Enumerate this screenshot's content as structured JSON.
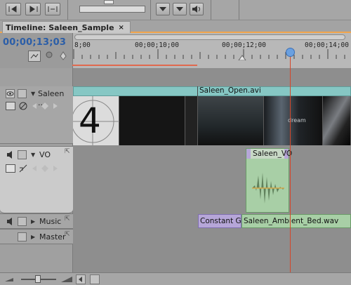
{
  "panel": {
    "tab_title": "Timeline: Saleen_Sample",
    "tab_close": "×",
    "timecode": "00;00;13;03"
  },
  "ruler": {
    "labels": [
      "8;00",
      "00;00;10;00",
      "00;00;12;00",
      "00;00;14;00"
    ]
  },
  "tracks": {
    "video1": {
      "name": "Saleen ...",
      "clip_name": "Saleen_Open.avi",
      "overlay_number": "4",
      "frame_text": "dream"
    },
    "vo": {
      "name": "VO",
      "clip_name": "Saleen_VO"
    },
    "music": {
      "name": "Music",
      "transition_label": "Constant Gair",
      "clip_name": "Saleen_Ambient_Bed.wav"
    },
    "master": {
      "name": "Master"
    }
  },
  "colors": {
    "accent_tab": "#f2a54c",
    "timecode": "#2b5ea8",
    "video_clip": "#86c7c4",
    "audio_clip": "#a8cfa6",
    "vo_clip": "#b6a6d8",
    "playhead": "#d4472a"
  },
  "icons": [
    "eye-icon",
    "speaker-icon",
    "snap-icon",
    "marker-icon",
    "keyframe-icon",
    "zoom-icon"
  ]
}
